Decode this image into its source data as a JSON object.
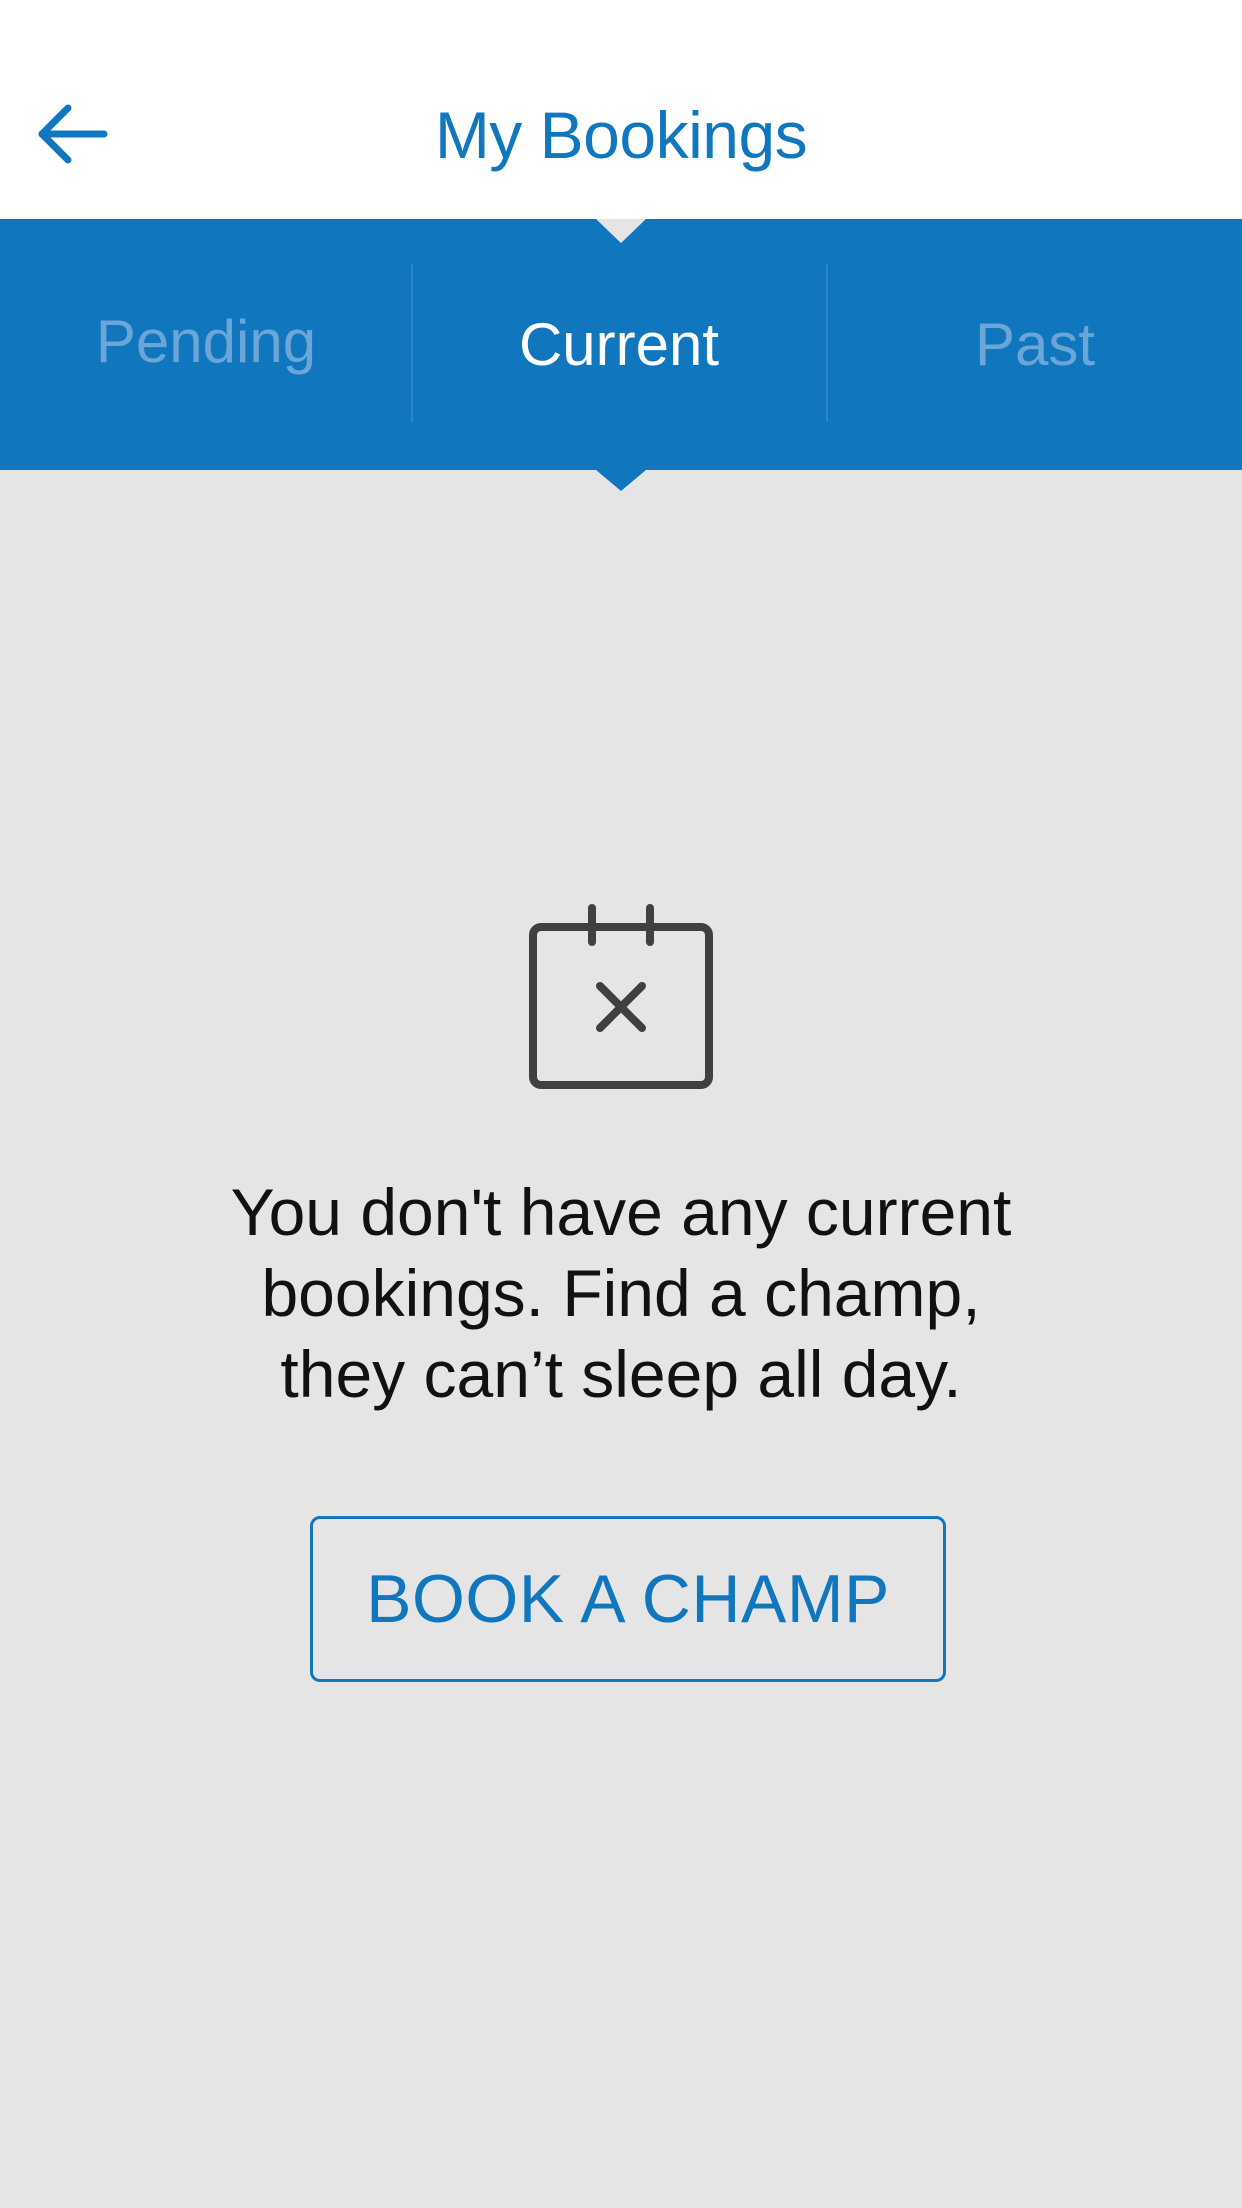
{
  "header": {
    "title": "My Bookings",
    "back_icon": "arrow-left-icon"
  },
  "tabs": [
    {
      "label": "Pending",
      "selected": false
    },
    {
      "label": "Current",
      "selected": true
    },
    {
      "label": "Past",
      "selected": false
    }
  ],
  "empty_state": {
    "icon": "calendar-x-icon",
    "message_lines": [
      "You don't have any current",
      "bookings. Find a champ,",
      "they can’t sleep all day."
    ],
    "button_label": "BOOK A CHAMP"
  },
  "colors": {
    "brand_blue": "#1077bf",
    "background": "#e5e5e6",
    "inactive_tab_text": "#6aa6d8",
    "icon_gray": "#404040"
  }
}
